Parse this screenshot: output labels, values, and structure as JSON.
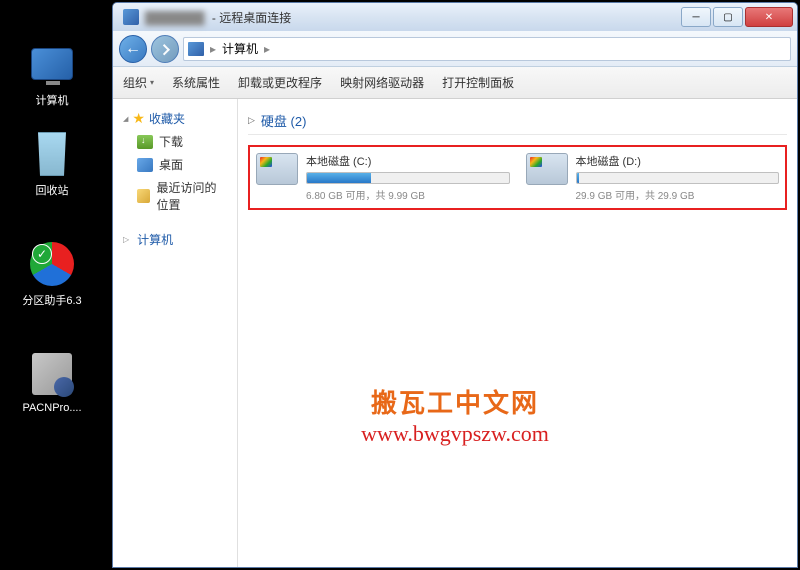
{
  "desktop_icons": {
    "computer": "计算机",
    "recycle": "回收站",
    "partition": "分区助手6.3",
    "pac": "PACNPro...."
  },
  "window": {
    "ip": "███████",
    "title": "远程桌面连接",
    "controls": {
      "min": "─",
      "max": "▢",
      "close": "✕"
    }
  },
  "nav": {
    "back": "←",
    "breadcrumb": "计算机",
    "sep": "▸"
  },
  "toolbar": {
    "organize": "组织",
    "properties": "系统属性",
    "uninstall": "卸载或更改程序",
    "map_drive": "映射网络驱动器",
    "control_panel": "打开控制面板"
  },
  "sidebar": {
    "favorites": "收藏夹",
    "downloads": "下载",
    "desktop": "桌面",
    "recent": "最近访问的位置",
    "computer": "计算机"
  },
  "main": {
    "section": "硬盘 (2)",
    "drives": [
      {
        "name": "本地磁盘 (C:)",
        "status": "6.80 GB 可用，共 9.99 GB",
        "fill": 32
      },
      {
        "name": "本地磁盘 (D:)",
        "status": "29.9 GB 可用，共 29.9 GB",
        "fill": 1
      }
    ]
  },
  "watermark": {
    "cn": "搬瓦工中文网",
    "url": "www.bwgvpszw.com"
  }
}
